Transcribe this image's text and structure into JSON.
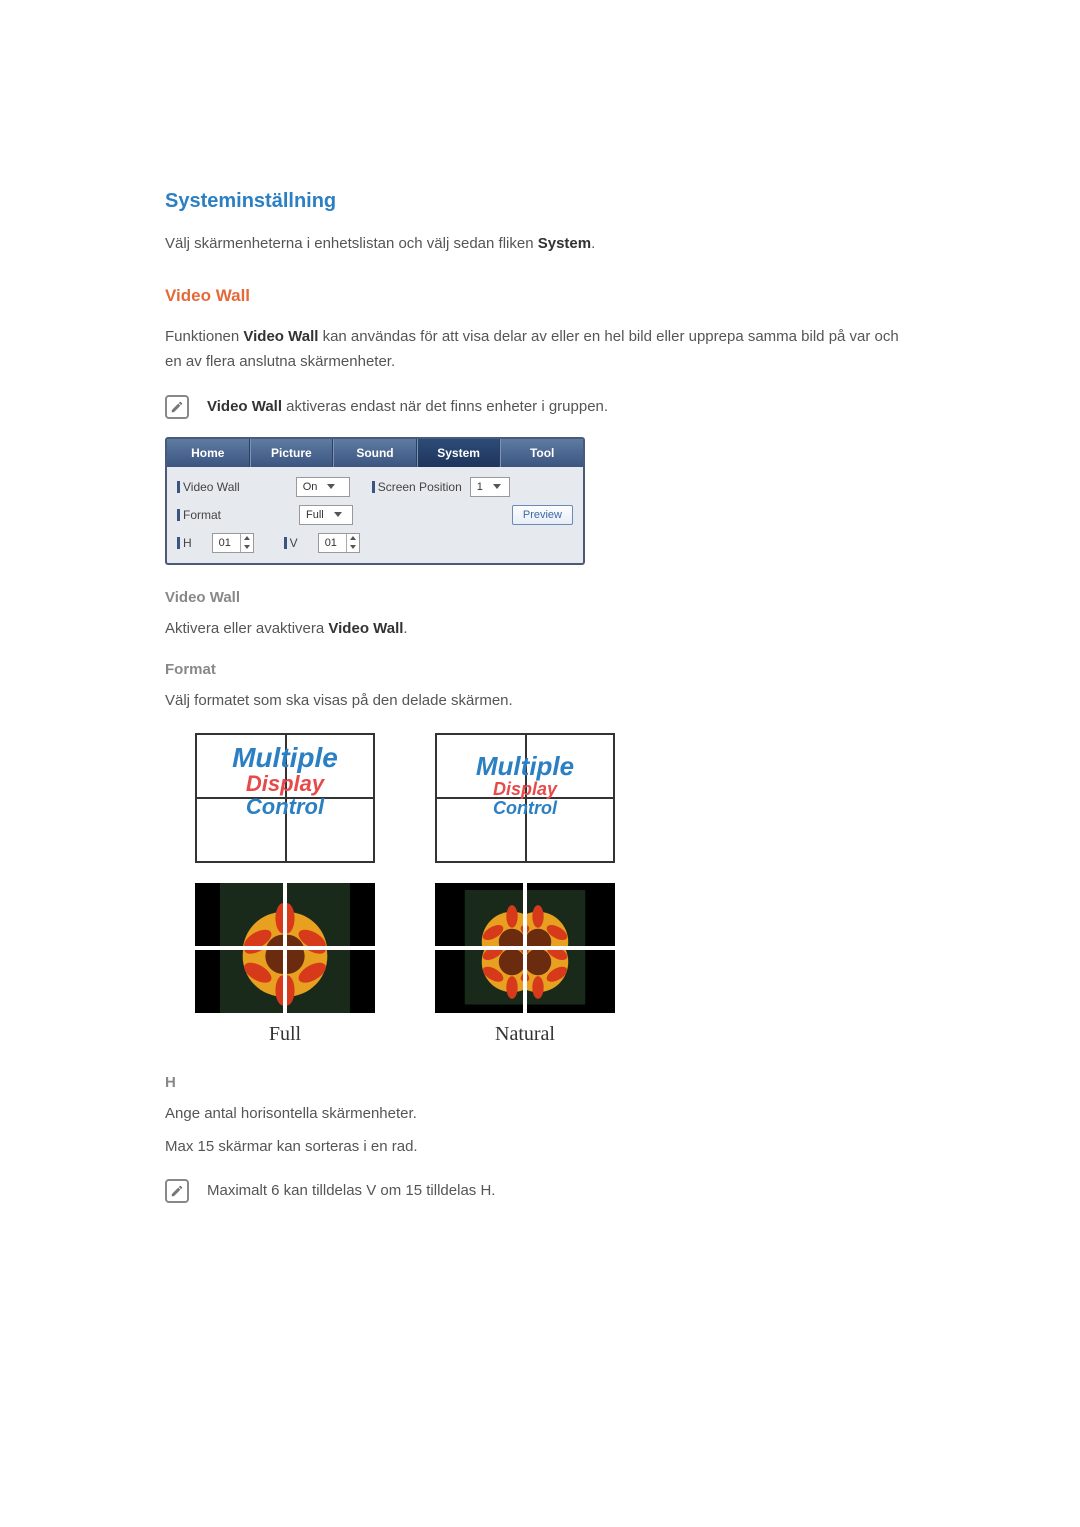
{
  "headings": {
    "system": "Systeminställning",
    "video_wall": "Video Wall",
    "sub_video_wall": "Video Wall",
    "sub_format": "Format",
    "sub_h": "H"
  },
  "intro": {
    "pre": "Välj skärmenheterna i enhetslistan och välj sedan fliken ",
    "bold": "System",
    "post": "."
  },
  "desc": {
    "pre": "Funktionen ",
    "bold": "Video Wall",
    "post": " kan användas för att visa delar av eller en hel bild eller upprepa samma bild på var och en av flera anslutna skärmenheter."
  },
  "note1": {
    "bold": "Video Wall",
    "post": " aktiveras endast när det finns enheter i gruppen."
  },
  "panel": {
    "tabs": [
      "Home",
      "Picture",
      "Sound",
      "System",
      "Tool"
    ],
    "active_index": 3,
    "video_wall_label": "Video Wall",
    "video_wall_value": "On",
    "screen_position_label": "Screen Position",
    "screen_position_value": "1",
    "format_label": "Format",
    "format_value": "Full",
    "preview_label": "Preview",
    "h_label": "H",
    "h_value": "01",
    "v_label": "V",
    "v_value": "01"
  },
  "sub_video_wall_desc": {
    "pre": "Aktivera eller avaktivera ",
    "bold": "Video Wall",
    "post": "."
  },
  "sub_format_desc": "Välj formatet som ska visas på den delade skärmen.",
  "logo": {
    "l1": "Multiple",
    "l2": "Display",
    "l3": "Control"
  },
  "captions": {
    "full": "Full",
    "natural": "Natural"
  },
  "h_desc1": "Ange antal horisontella skärmenheter.",
  "h_desc2": "Max 15 skärmar kan sorteras i en rad.",
  "note2": "Maximalt 6 kan tilldelas V om 15 tilldelas H."
}
